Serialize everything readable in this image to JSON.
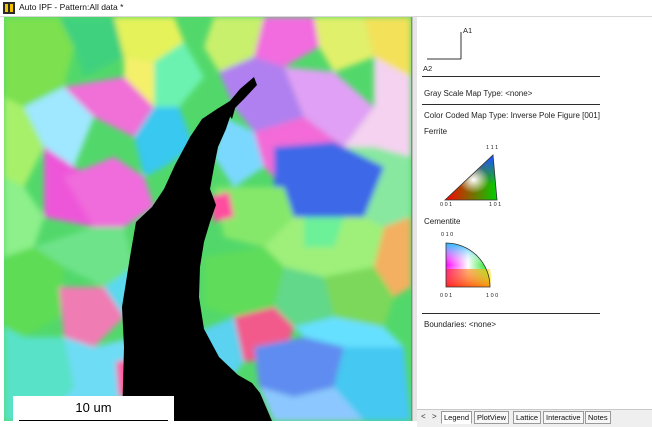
{
  "window": {
    "title": "Auto IPF - Pattern:All data *"
  },
  "map": {
    "scale_bar_label": "10 um"
  },
  "legend": {
    "axis_a1": "A1",
    "axis_a2": "A2",
    "gray_scale_map": "Gray Scale Map Type: <none>",
    "color_coded_map": "Color Coded Map Type: Inverse Pole Figure [001]",
    "phases": [
      {
        "name": "Ferrite",
        "corner_top": "1 1 1",
        "corner_left": "0 0 1",
        "corner_right": "1 0 1"
      },
      {
        "name": "Cementite",
        "corner_top": "0 1 0",
        "corner_left": "0 0 1",
        "corner_right": "1 0 0"
      }
    ],
    "boundaries": "Boundaries: <none>"
  },
  "tabs": {
    "nav_prev": "<",
    "nav_next": ">",
    "items": [
      "Legend",
      "PlotView",
      "Lattice",
      "Interactive",
      "Notes"
    ],
    "active": "Legend"
  }
}
